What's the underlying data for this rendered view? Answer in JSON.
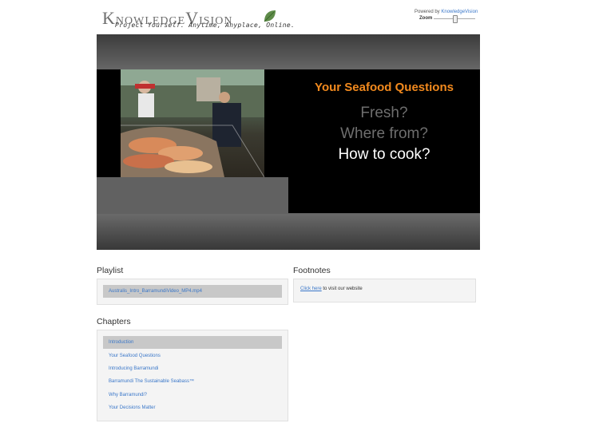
{
  "header": {
    "logo_k": "K",
    "logo_rest1": "nowledge",
    "logo_v": "V",
    "logo_rest2": "ision",
    "tagline": "Project Yourself. Anytime, Anyplace, Online.",
    "powered_prefix": "Powered by ",
    "powered_link": "KnowledgeVision",
    "zoom_label": "Zoom",
    "zoom_level": 0.5
  },
  "slide": {
    "title": "Your Seafood Questions",
    "items": [
      "Fresh?",
      "Where from?",
      "How to cook?"
    ]
  },
  "playlist": {
    "title": "Playlist",
    "items": [
      "Australis_Intro_BarramundiVideo_MP4.mp4"
    ]
  },
  "footnotes": {
    "title": "Footnotes",
    "link": "Click here",
    "text": " to visit our website"
  },
  "chapters": {
    "title": "Chapters",
    "items": [
      "Introduction",
      "Your Seafood Questions",
      "Introducing Barramundi",
      "Barramundi The Sustainable Seabass™",
      "Why Barramundi?",
      "Your Decisions Matter"
    ]
  },
  "colors": {
    "accent_link": "#3a77c9",
    "slide_title": "#f28a1e",
    "active_row": "#c8c8c8"
  }
}
